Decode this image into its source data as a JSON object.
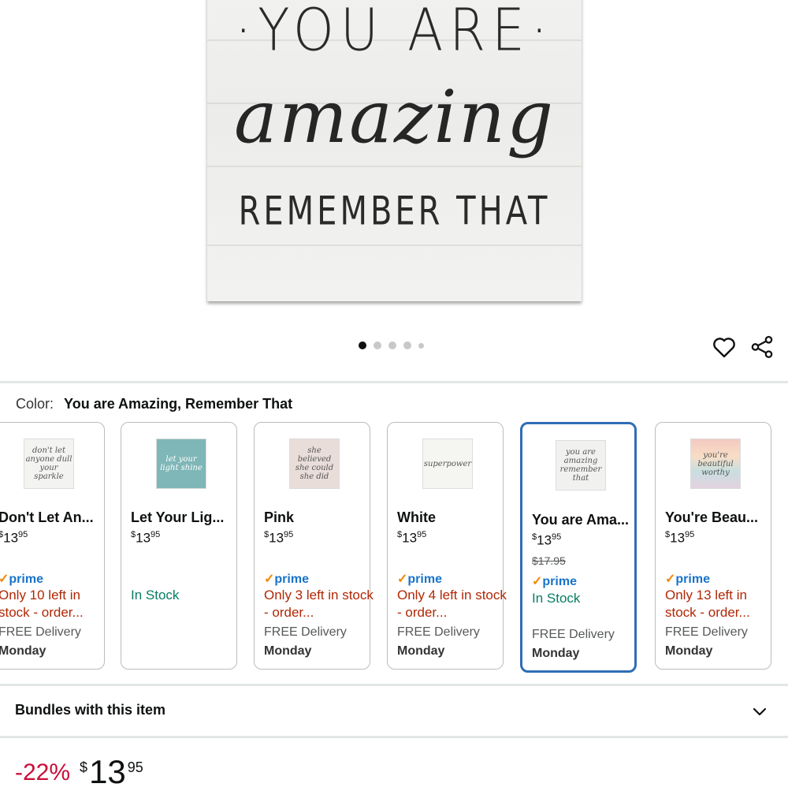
{
  "hero": {
    "sign_line1": "·YOU ARE·",
    "sign_line2": "amazing",
    "sign_line3": "REMEMBER THAT",
    "carousel_dots": 5,
    "active_dot": 1
  },
  "actions": {
    "wishlist_icon": "heart-icon",
    "share_icon": "share-icon"
  },
  "color": {
    "label": "Color:",
    "value": "You are Amazing, Remember That"
  },
  "variants": [
    {
      "name": "Don't Let An...",
      "price_dollars": "13",
      "price_cents": "95",
      "prime": "prime",
      "stock": "Only 10 left in stock - order...",
      "stock_status": "low",
      "delivery": "FREE Delivery",
      "delivery_day": "Monday",
      "thumb_text": "don't let anyone dull your sparkle"
    },
    {
      "name": "Let Your Lig...",
      "price_dollars": "13",
      "price_cents": "95",
      "stock": "In Stock",
      "stock_status": "in",
      "thumb_text": "let your light shine"
    },
    {
      "name": "Pink",
      "price_dollars": "13",
      "price_cents": "95",
      "prime": "prime",
      "stock": "Only 3 left in stock - order...",
      "stock_status": "low",
      "delivery": "FREE Delivery",
      "delivery_day": "Monday",
      "thumb_text": "she believed she could she did"
    },
    {
      "name": "White",
      "price_dollars": "13",
      "price_cents": "95",
      "prime": "prime",
      "stock": "Only 4 left in stock - order...",
      "stock_status": "low",
      "delivery": "FREE Delivery",
      "delivery_day": "Monday",
      "thumb_text": "superpower"
    },
    {
      "name": "You are Ama...",
      "price_dollars": "13",
      "price_cents": "95",
      "list_price": "$17.95",
      "prime": "prime",
      "stock": "In Stock",
      "stock_status": "in",
      "delivery": "FREE Delivery",
      "delivery_day": "Monday",
      "selected": true,
      "thumb_text": "you are amazing remember that"
    },
    {
      "name": "You're Beau...",
      "price_dollars": "13",
      "price_cents": "95",
      "prime": "prime",
      "stock": "Only 13 left in stock - order...",
      "stock_status": "low",
      "delivery": "FREE Delivery",
      "delivery_day": "Monday",
      "thumb_text": "you're beautiful worthy"
    }
  ],
  "bundles": {
    "label": "Bundles with this item",
    "icon": "chevron-down-icon"
  },
  "price": {
    "discount": "-22%",
    "currency": "$",
    "dollars": "13",
    "cents": "95"
  },
  "colors": {
    "prime_blue": "#1a73c8",
    "deal_red": "#cc0c39",
    "selected_border": "#2f6db5"
  }
}
